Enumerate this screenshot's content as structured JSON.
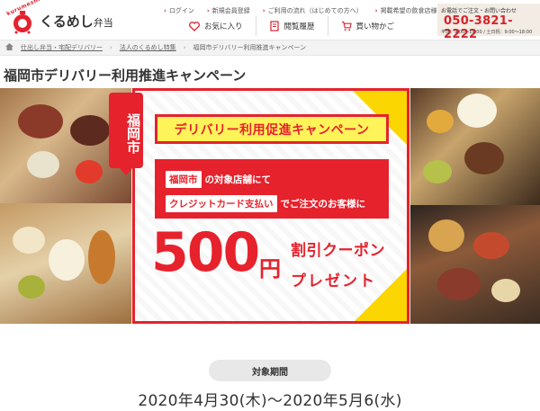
{
  "header": {
    "logo_arc": "kurumeshi",
    "logo_name": "くるめし",
    "logo_sub": "弁当",
    "top_links": [
      "ログイン",
      "新規会員登録",
      "ご利用の流れ（はじめての方へ）",
      "掲載希望の飲食店様へ"
    ],
    "icon_buttons": [
      {
        "icon": "heart-icon",
        "label": "お気に入り"
      },
      {
        "icon": "history-icon",
        "label": "閲覧履歴"
      },
      {
        "icon": "cart-icon",
        "label": "買い物かご"
      }
    ],
    "phone": {
      "note": "お電話でご注文・お問い合わせ",
      "number": "050-3821-2222",
      "hours": "平日：9:00〜19:00 / 土日祝：9:00〜18:00"
    }
  },
  "breadcrumb": {
    "items": [
      "仕出し弁当・宅配デリバリー",
      "法人のくるめし特集",
      "福岡市デリバリー利用推進キャンペーン"
    ]
  },
  "page": {
    "title": "福岡市デリバリー利用推進キャンペーン"
  },
  "banner": {
    "city_tag": "福岡市",
    "campaign_title": "デリバリー利用促進キャンペーン",
    "line1_chip": "福岡市",
    "line1_text": "の対象店舗にて",
    "line2_chip": "クレジットカード支払い",
    "line2_text": "でご注文のお客様に",
    "amount": "500",
    "yen": "円",
    "discount": "割引クーポン",
    "present": "プレゼント"
  },
  "period": {
    "label": "対象期間",
    "dates": "2020年4月30(木)～2020年5月6(水)"
  },
  "colors": {
    "brand_red": "#e6222d",
    "highlight_yellow": "#fff35a",
    "phone_bg": "#f2ece4"
  }
}
